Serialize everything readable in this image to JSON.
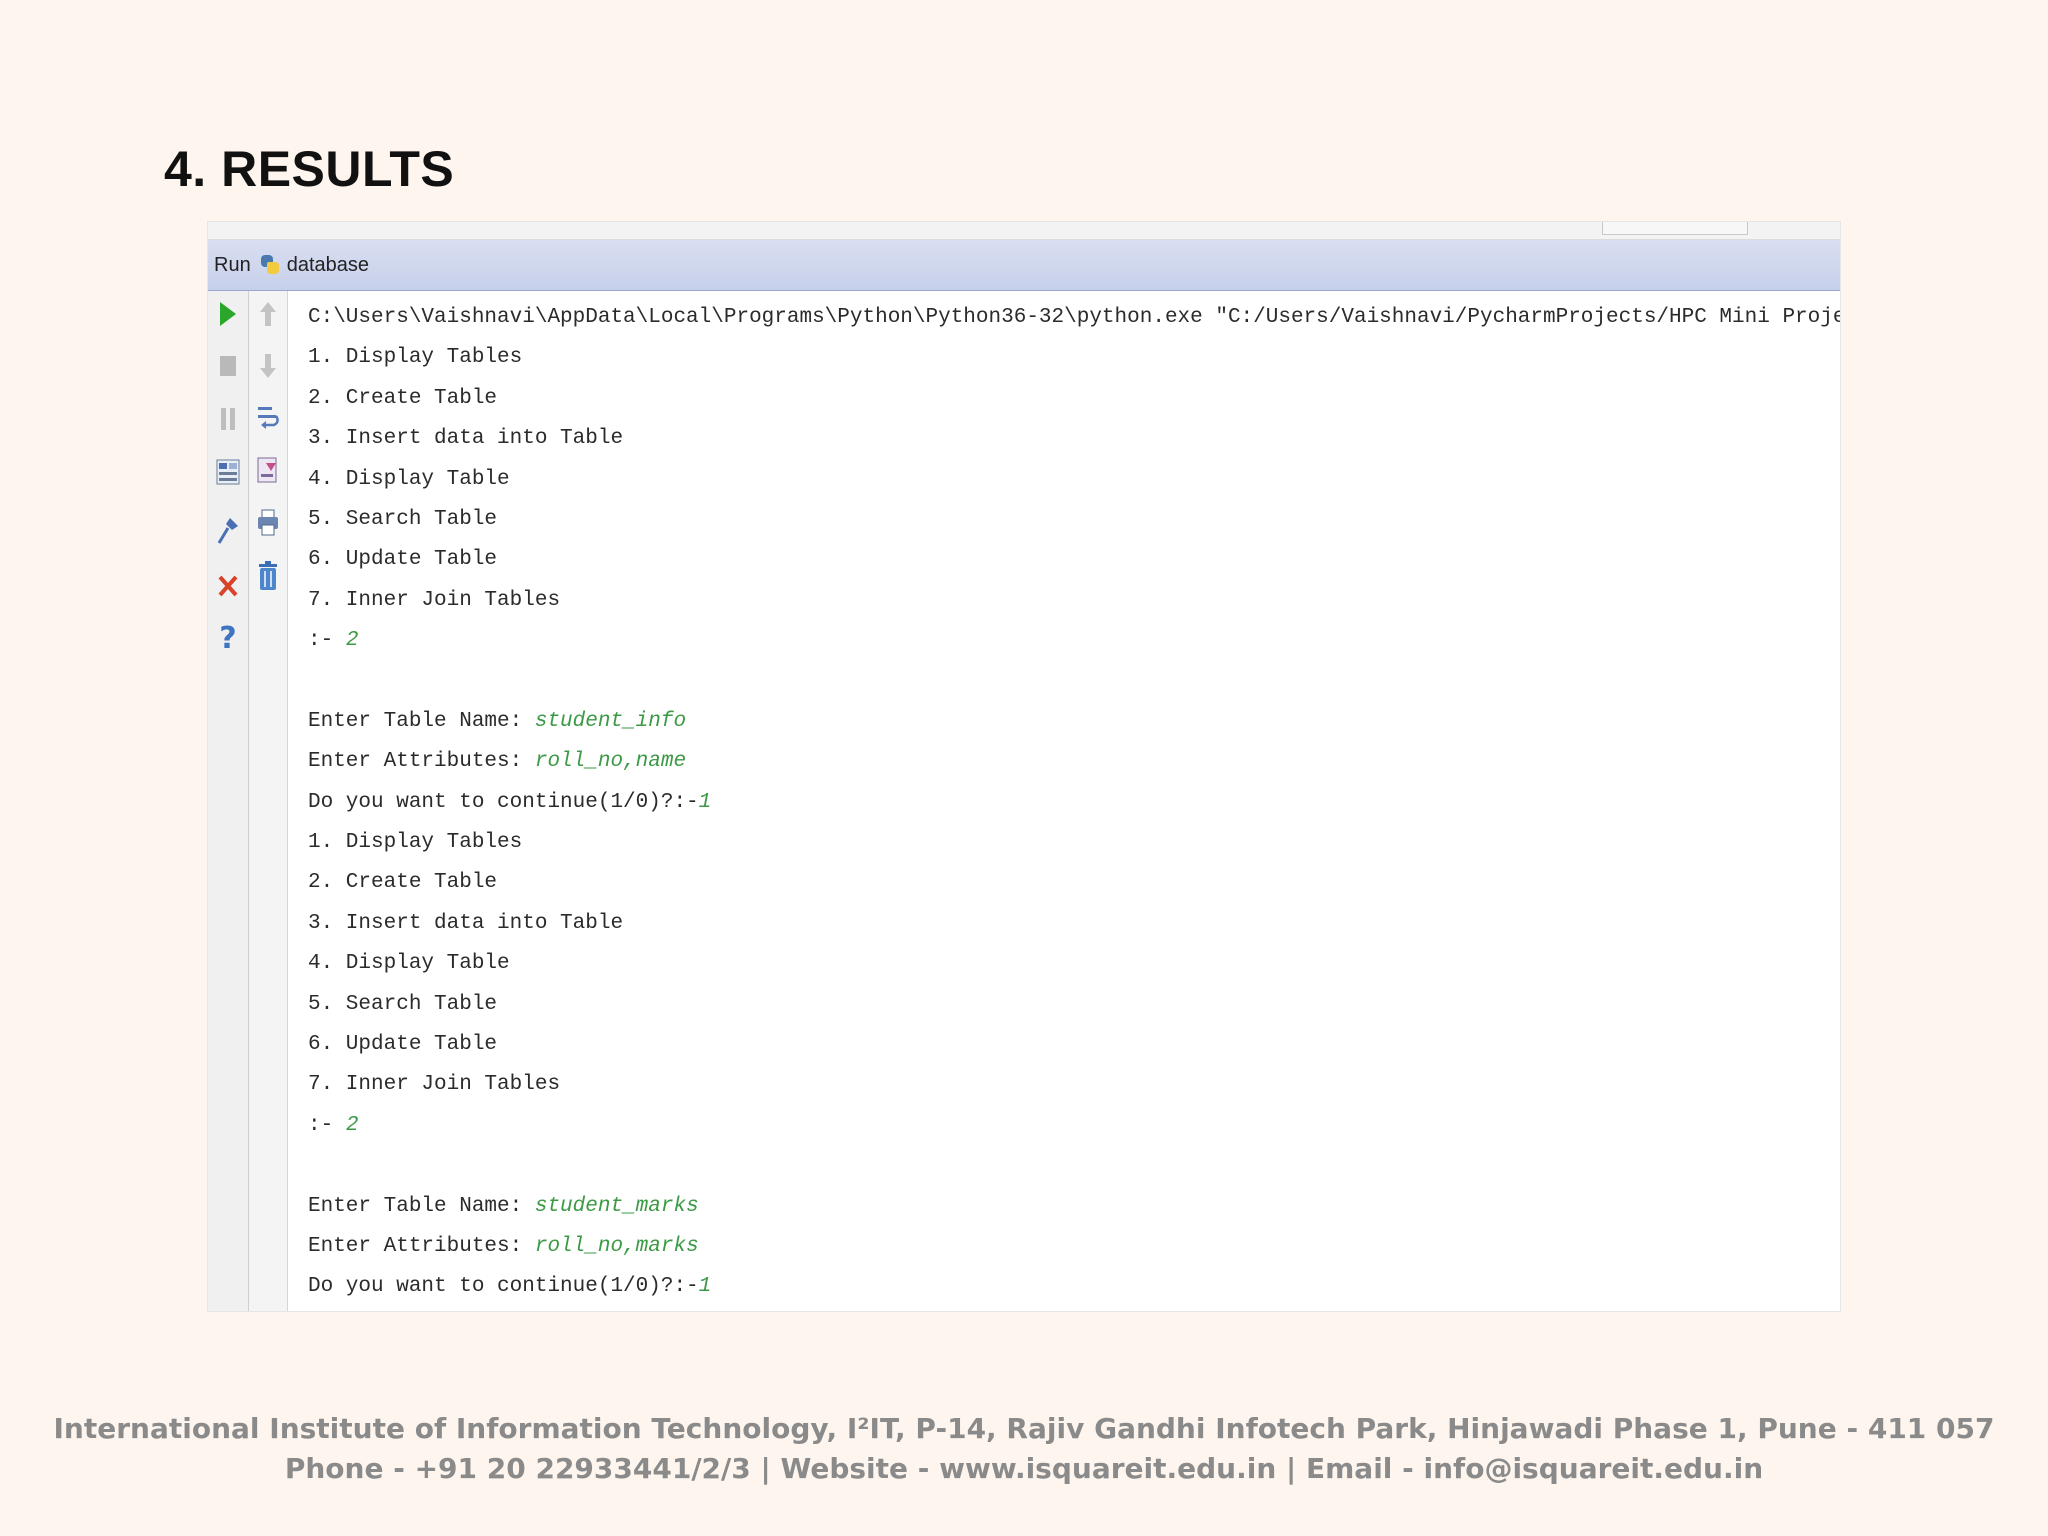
{
  "slide": {
    "title": "4. RESULTS"
  },
  "run_panel": {
    "tab_label": "Run",
    "config_name": "database",
    "icons_left": [
      "run-icon",
      "stop-icon",
      "pause-icon",
      "layout-icon",
      "pin-icon",
      "close-icon",
      "help-icon"
    ],
    "icons_right": [
      "up-arrow-icon",
      "down-arrow-icon",
      "soft-wrap-icon",
      "scroll-to-end-icon",
      "print-icon",
      "trash-icon"
    ]
  },
  "console": {
    "lines": [
      {
        "text": "C:\\Users\\Vaishnavi\\AppData\\Local\\Programs\\Python\\Python36-32\\python.exe \"C:/Users/Vaishnavi/PycharmProjects/HPC Mini Project/database\"",
        "input": ""
      },
      {
        "text": "1. Display Tables",
        "input": ""
      },
      {
        "text": "2. Create Table",
        "input": ""
      },
      {
        "text": "3. Insert data into Table",
        "input": ""
      },
      {
        "text": "4. Display Table",
        "input": ""
      },
      {
        "text": "5. Search Table",
        "input": ""
      },
      {
        "text": "6. Update Table",
        "input": ""
      },
      {
        "text": "7. Inner Join Tables",
        "input": ""
      },
      {
        "text": ":- ",
        "input": "2"
      },
      {
        "text": "",
        "input": ""
      },
      {
        "text": "Enter Table Name: ",
        "input": "student_info"
      },
      {
        "text": "Enter Attributes: ",
        "input": "roll_no,name"
      },
      {
        "text": "Do you want to continue(1/0)?:-",
        "input": "1"
      },
      {
        "text": "1. Display Tables",
        "input": ""
      },
      {
        "text": "2. Create Table",
        "input": ""
      },
      {
        "text": "3. Insert data into Table",
        "input": ""
      },
      {
        "text": "4. Display Table",
        "input": ""
      },
      {
        "text": "5. Search Table",
        "input": ""
      },
      {
        "text": "6. Update Table",
        "input": ""
      },
      {
        "text": "7. Inner Join Tables",
        "input": ""
      },
      {
        "text": ":- ",
        "input": "2"
      },
      {
        "text": "",
        "input": ""
      },
      {
        "text": "Enter Table Name: ",
        "input": "student_marks"
      },
      {
        "text": "Enter Attributes: ",
        "input": "roll_no,marks"
      },
      {
        "text": "Do you want to continue(1/0)?:-",
        "input": "1"
      }
    ]
  },
  "footer": {
    "line1": "International Institute of Information Technology, I²IT, P-14, Rajiv Gandhi Infotech Park, Hinjawadi Phase 1, Pune - 411 057",
    "line2": "Phone - +91 20 22933441/2/3 | Website - www.isquareit.edu.in | Email - info@isquareit.edu.in"
  },
  "colors": {
    "background": "#fdf5ee",
    "header_bar": "#c7d0ea",
    "user_input": "#3c9a45",
    "footer_text": "#8a8a8a"
  }
}
